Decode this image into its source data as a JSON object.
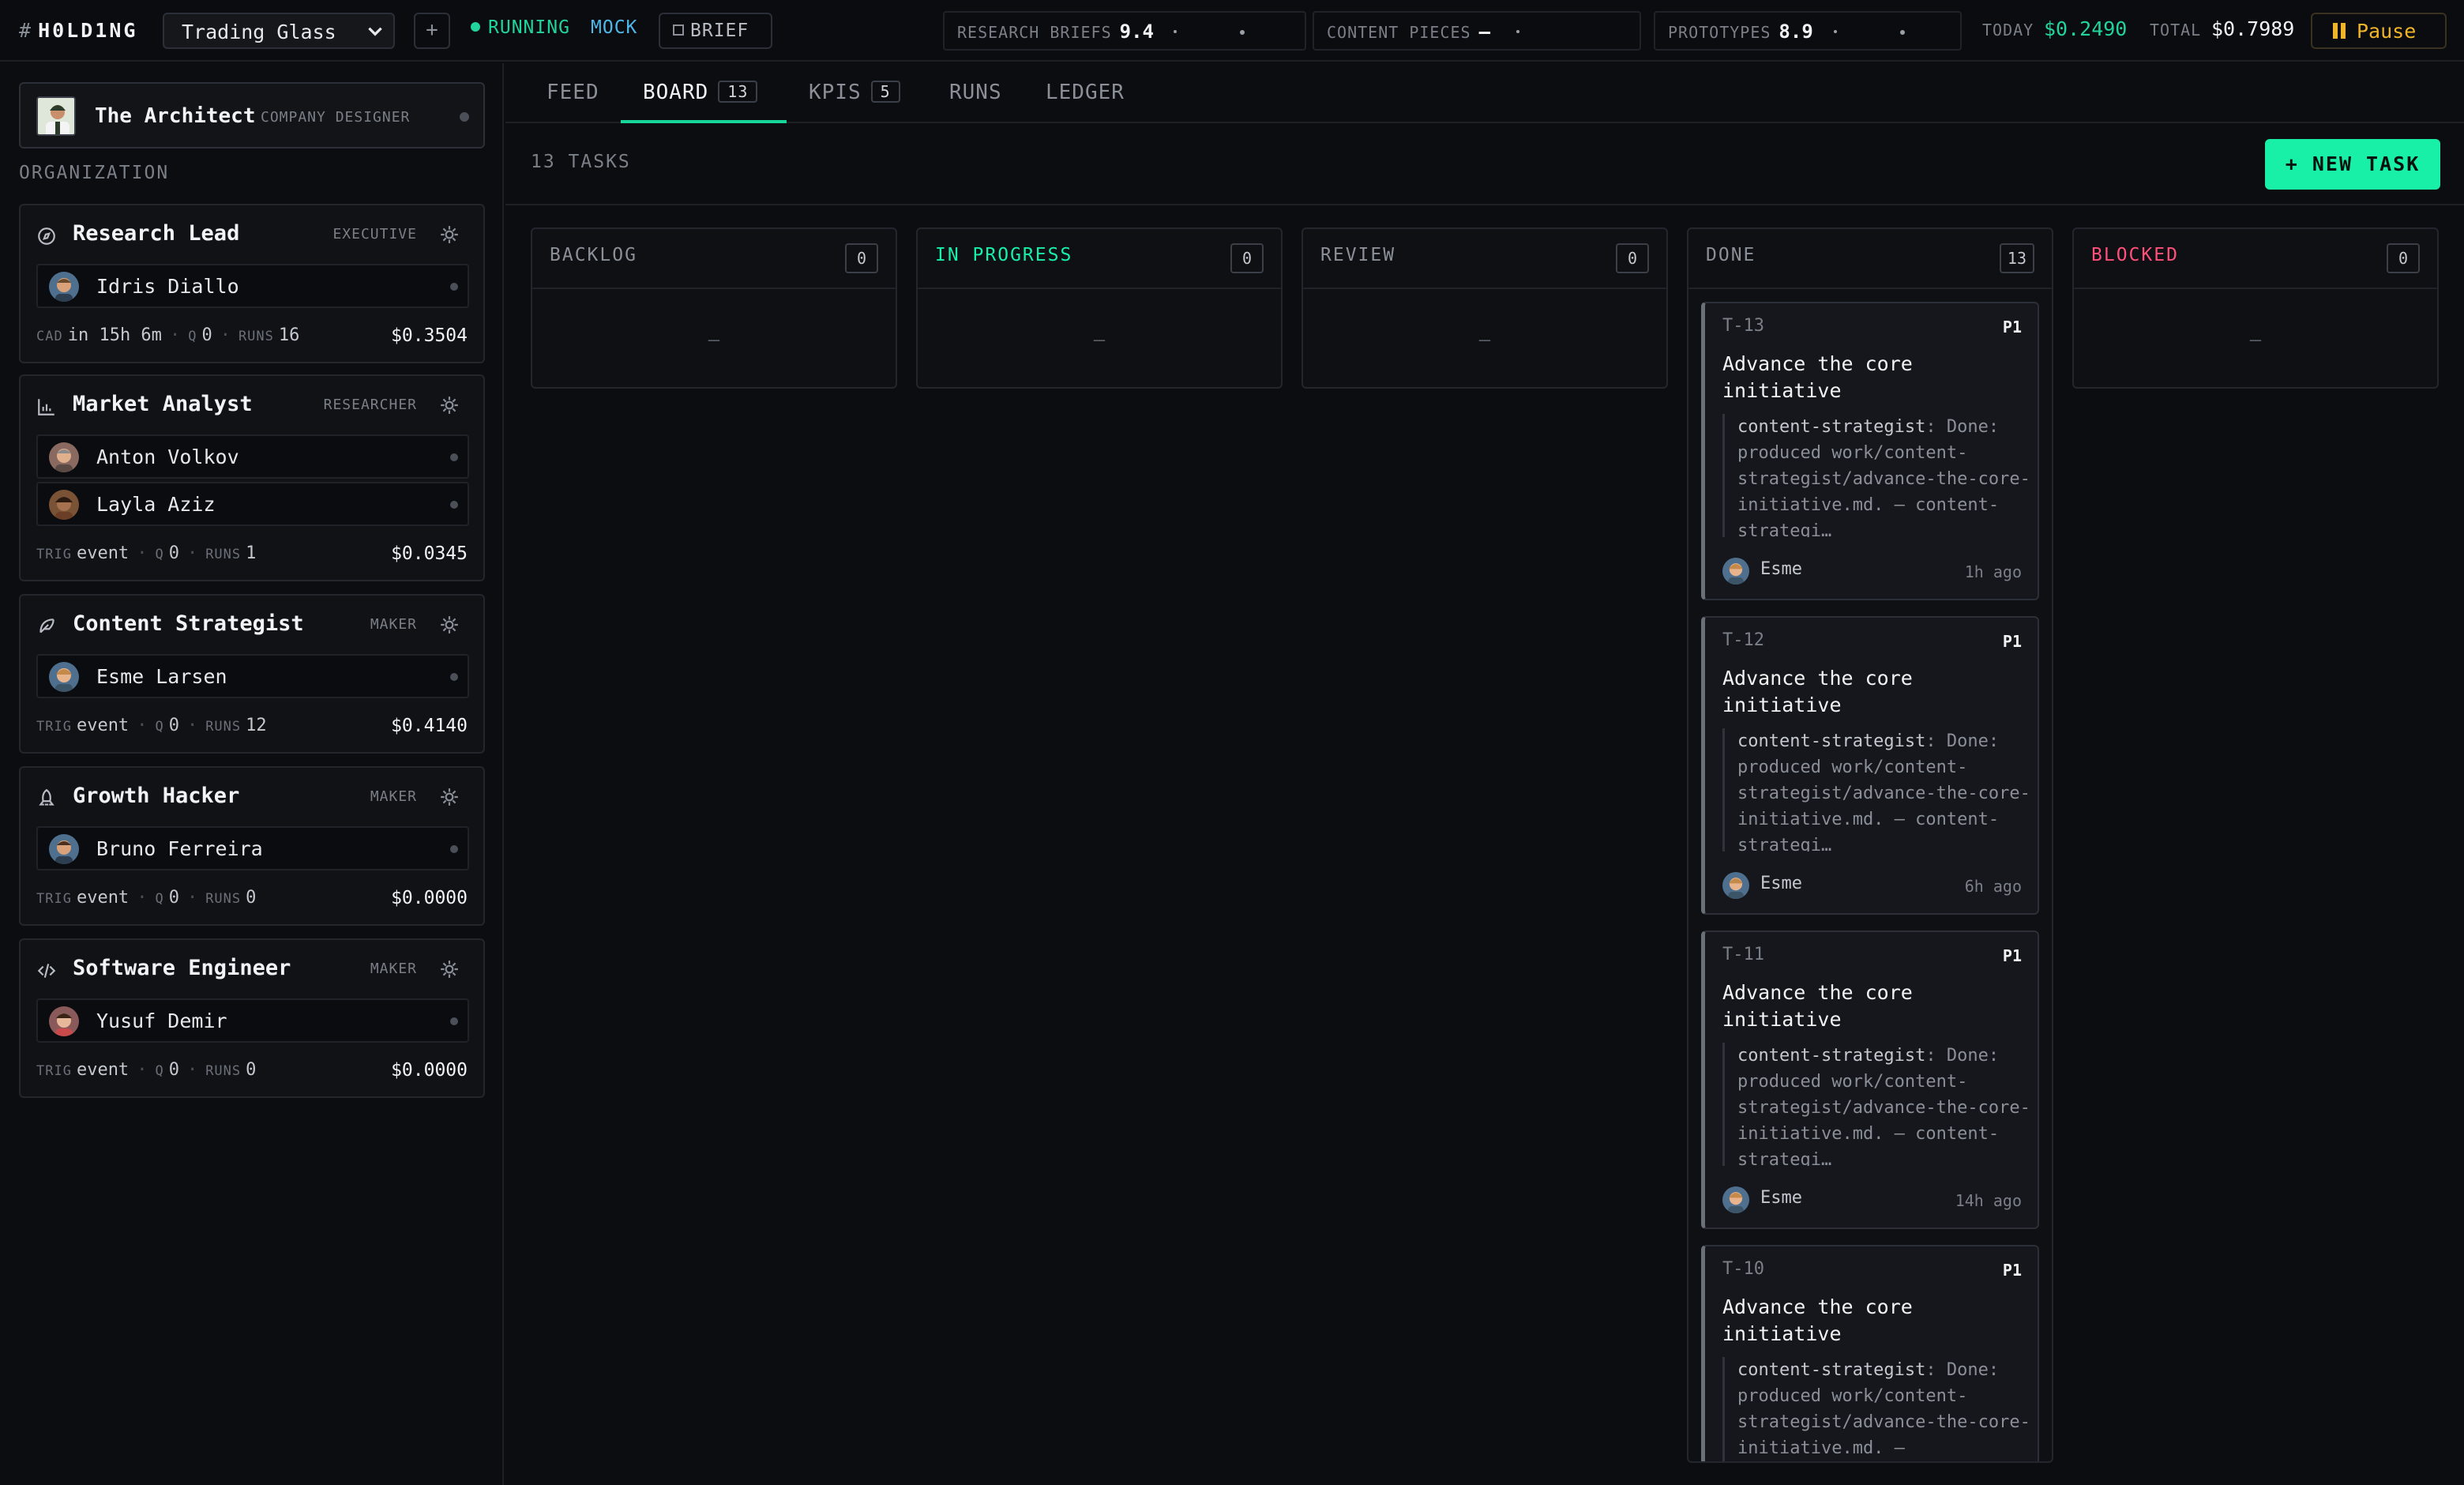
{
  "brand": {
    "hash": "#",
    "name": "H0LD1NG"
  },
  "company": {
    "selected": "Trading Glass",
    "add_label": "+"
  },
  "status": {
    "running": "RUNNING",
    "mode": "MOCK",
    "brief": "BRIEF"
  },
  "kpis": [
    {
      "label": "RESEARCH BRIEFS",
      "value": "9.4"
    },
    {
      "label": "CONTENT PIECES",
      "value": "—"
    },
    {
      "label": "PROTOTYPES",
      "value": "8.9"
    }
  ],
  "spend": {
    "today_label": "TODAY",
    "today": "$0.2490",
    "total_label": "TOTAL",
    "total": "$0.7989"
  },
  "pause_label": "Pause",
  "colors": {
    "accent": "#18f0a8",
    "running": "#21d49a",
    "mock": "#4fb7e8",
    "pause": "#f0b429",
    "blocked": "#ff4f7b"
  },
  "architect": {
    "name": "The Architect",
    "role": "COMPANY DESIGNER"
  },
  "org_label": "ORGANIZATION",
  "departments": [
    {
      "icon": "compass-icon",
      "name": "Research Lead",
      "tier": "EXECUTIVE",
      "agents": [
        {
          "name": "Idris Diallo"
        }
      ],
      "meta_k1": "CAD",
      "meta_v1": "in 15h 6m",
      "q_label": "Q",
      "q": "0",
      "runs_label": "RUNS",
      "runs": "16",
      "cost": "$0.3504"
    },
    {
      "icon": "bar-chart-icon",
      "name": "Market Analyst",
      "tier": "RESEARCHER",
      "agents": [
        {
          "name": "Anton Volkov"
        },
        {
          "name": "Layla Aziz"
        }
      ],
      "meta_k1": "TRIG",
      "meta_v1": "event",
      "q_label": "Q",
      "q": "0",
      "runs_label": "RUNS",
      "runs": "1",
      "cost": "$0.0345"
    },
    {
      "icon": "feather-icon",
      "name": "Content Strategist",
      "tier": "MAKER",
      "agents": [
        {
          "name": "Esme Larsen"
        }
      ],
      "meta_k1": "TRIG",
      "meta_v1": "event",
      "q_label": "Q",
      "q": "0",
      "runs_label": "RUNS",
      "runs": "12",
      "cost": "$0.4140"
    },
    {
      "icon": "rocket-icon",
      "name": "Growth Hacker",
      "tier": "MAKER",
      "agents": [
        {
          "name": "Bruno Ferreira"
        }
      ],
      "meta_k1": "TRIG",
      "meta_v1": "event",
      "q_label": "Q",
      "q": "0",
      "runs_label": "RUNS",
      "runs": "0",
      "cost": "$0.0000"
    },
    {
      "icon": "code-icon",
      "name": "Software Engineer",
      "tier": "MAKER",
      "agents": [
        {
          "name": "Yusuf Demir"
        }
      ],
      "meta_k1": "TRIG",
      "meta_v1": "event",
      "q_label": "Q",
      "q": "0",
      "runs_label": "RUNS",
      "runs": "0",
      "cost": "$0.0000"
    }
  ],
  "tabs": [
    {
      "label": "FEED",
      "count": null
    },
    {
      "label": "BOARD",
      "count": "13",
      "active": true
    },
    {
      "label": "KPIS",
      "count": "5"
    },
    {
      "label": "RUNS",
      "count": null
    },
    {
      "label": "LEDGER",
      "count": null
    }
  ],
  "board": {
    "task_count": "13 TASKS",
    "new_task_label": "+ NEW TASK",
    "empty_text": "—",
    "columns": [
      {
        "title": "BACKLOG",
        "count": "0"
      },
      {
        "title": "IN PROGRESS",
        "count": "0"
      },
      {
        "title": "REVIEW",
        "count": "0"
      },
      {
        "title": "DONE",
        "count": "13"
      },
      {
        "title": "BLOCKED",
        "count": "0"
      }
    ],
    "cards": [
      {
        "id": "T-13",
        "priority": "P1",
        "title": "Advance the core initiative",
        "note_who": "content-strategist",
        "note": ": Done: produced work/content-strategist/advance-the-core-initiative.md. — content-strategi…",
        "assignee": "Esme",
        "time": "1h ago"
      },
      {
        "id": "T-12",
        "priority": "P1",
        "title": "Advance the core initiative",
        "note_who": "content-strategist",
        "note": ": Done: produced work/content-strategist/advance-the-core-initiative.md. — content-strategi…",
        "assignee": "Esme",
        "time": "6h ago"
      },
      {
        "id": "T-11",
        "priority": "P1",
        "title": "Advance the core initiative",
        "note_who": "content-strategist",
        "note": ": Done: produced work/content-strategist/advance-the-core-initiative.md. — content-strategi…",
        "assignee": "Esme",
        "time": "14h ago"
      },
      {
        "id": "T-10",
        "priority": "P1",
        "title": "Advance the core initiative",
        "note_who": "content-strategist",
        "note": ": Done: produced work/content-strategist/advance-the-core-initiative.md. —",
        "assignee": "",
        "time": ""
      }
    ]
  }
}
